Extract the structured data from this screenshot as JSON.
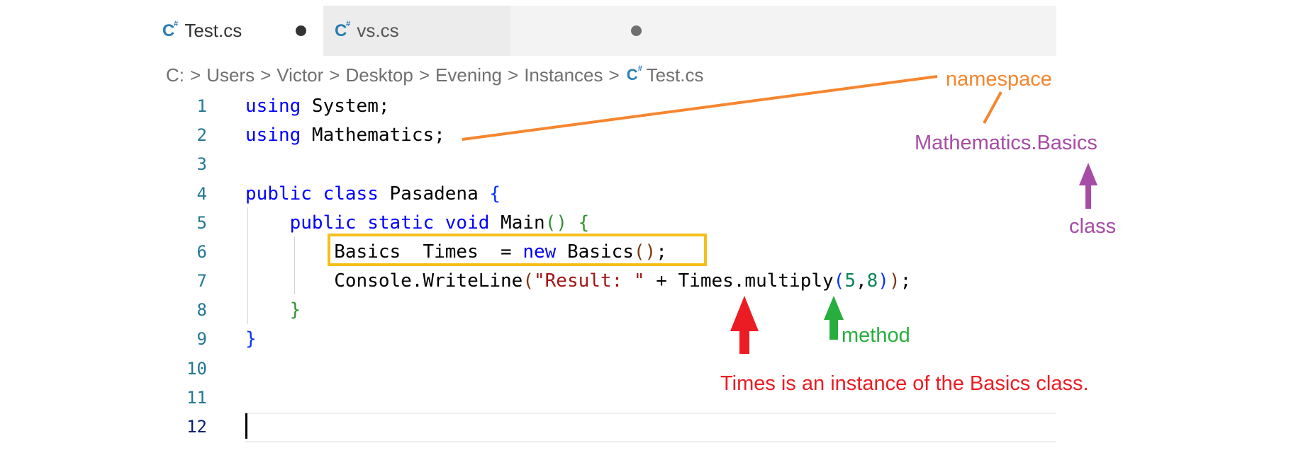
{
  "tabs": [
    {
      "icon": "csharp-file-icon",
      "label": "Test.cs",
      "active": true,
      "modified": true
    },
    {
      "icon": "csharp-file-icon",
      "label": "vs.cs",
      "active": false,
      "modified": true
    }
  ],
  "breadcrumb": {
    "items": [
      "C:",
      "Users",
      "Victor",
      "Desktop",
      "Evening",
      "Instances"
    ],
    "file": "Test.cs",
    "separator": ">"
  },
  "code": {
    "line_numbers": [
      "1",
      "2",
      "3",
      "4",
      "5",
      "6",
      "7",
      "8",
      "9",
      "10",
      "11",
      "12"
    ],
    "active_line": "12"
  },
  "annotations": {
    "namespace": "namespace",
    "full_class": "Mathematics.Basics",
    "class": "class",
    "method": "method",
    "instance_note": "Times is an instance of the Basics class."
  },
  "colors": {
    "namespace_arrow": "#f5862f",
    "class_arrow": "#a64ca6",
    "instance_arrow": "#ec1c24",
    "method_arrow": "#27ae3f",
    "highlight_box": "#f5bf1a",
    "keyword": "#0000ff"
  }
}
